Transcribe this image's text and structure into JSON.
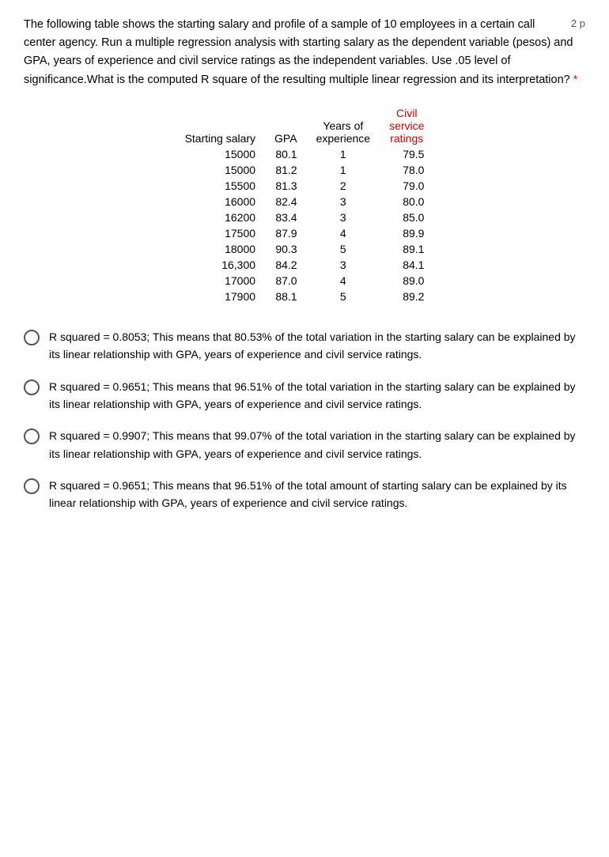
{
  "page": {
    "indicator": "2 p",
    "question": "The following table shows the starting salary and profile of a sample of 10 employees in a certain call center agency. Run a multiple regression analysis with starting salary as the dependent variable (pesos) and GPA, years of experience and civil service ratings as the independent variables. Use .05 level of significance.What is the computed R square of the resulting multiple linear regression and its interpretation?",
    "required": "*"
  },
  "table": {
    "headers": [
      "Starting salary",
      "GPA",
      "Years of experience",
      "Civil service ratings"
    ],
    "rows": [
      [
        "15000",
        "80.1",
        "1",
        "79.5"
      ],
      [
        "15000",
        "81.2",
        "1",
        "78.0"
      ],
      [
        "15500",
        "81.3",
        "2",
        "79.0"
      ],
      [
        "16000",
        "82.4",
        "3",
        "80.0"
      ],
      [
        "16200",
        "83.4",
        "3",
        "85.0"
      ],
      [
        "17500",
        "87.9",
        "4",
        "89.9"
      ],
      [
        "18000",
        "90.3",
        "5",
        "89.1"
      ],
      [
        "16,300",
        "84.2",
        "3",
        "84.1"
      ],
      [
        "17000",
        "87.0",
        "4",
        "89.0"
      ],
      [
        "17900",
        "88.1",
        "5",
        "89.2"
      ]
    ]
  },
  "options": [
    {
      "id": "option1",
      "text": "R squared = 0.8053; This means that 80.53% of the total variation in the starting salary can be explained by its linear relationship with GPA, years of experience and civil service ratings."
    },
    {
      "id": "option2",
      "text": "R squared = 0.9651; This means that 96.51% of the total variation in the starting salary can be explained by its linear relationship with GPA, years of experience and civil service ratings."
    },
    {
      "id": "option3",
      "text": "R squared = 0.9907; This means that 99.07% of the total variation in the starting salary can be explained by its linear relationship with GPA, years of experience and civil service ratings."
    },
    {
      "id": "option4",
      "text": "R squared = 0.9651; This means that 96.51% of the total amount of starting salary can be explained by its linear relationship with GPA, years of experience and civil service ratings."
    }
  ]
}
